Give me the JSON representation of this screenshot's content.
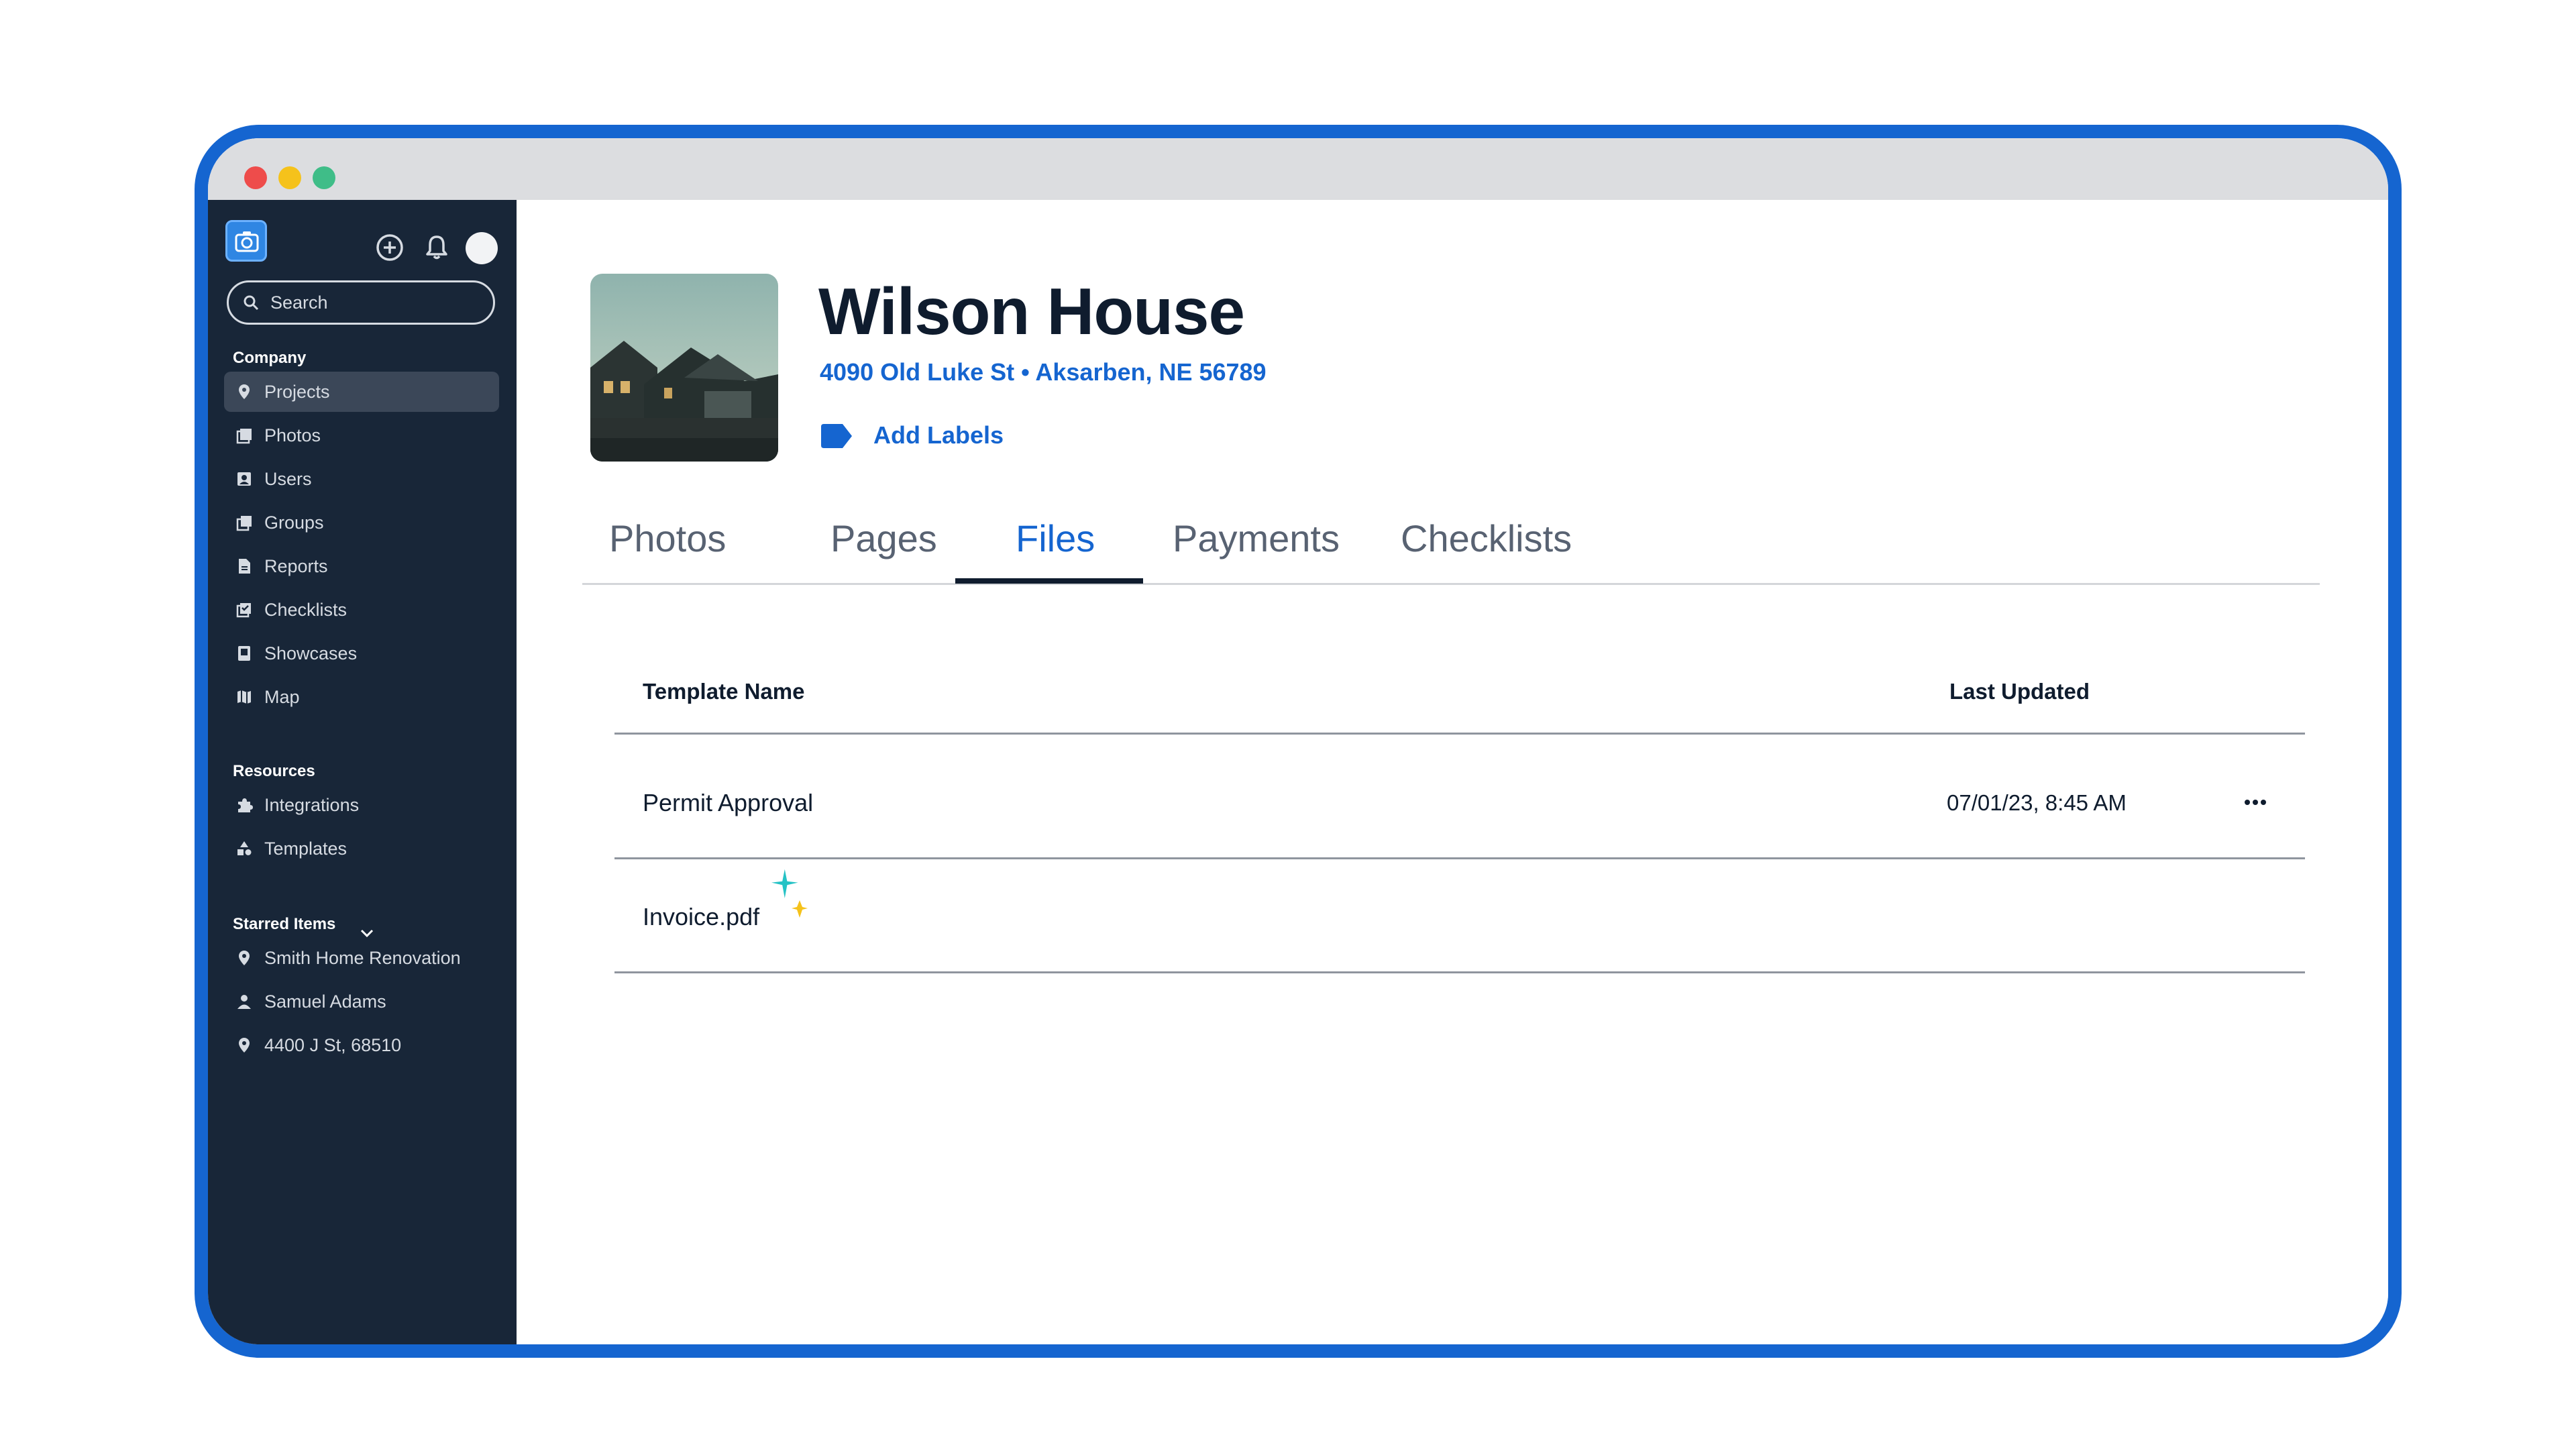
{
  "sidebar": {
    "search_placeholder": "Search",
    "company_title": "Company",
    "company_items": [
      {
        "label": "Projects",
        "icon": "pin-icon",
        "active": true
      },
      {
        "label": "Photos",
        "icon": "photos-icon"
      },
      {
        "label": "Users",
        "icon": "user-card-icon"
      },
      {
        "label": "Groups",
        "icon": "groups-icon"
      },
      {
        "label": "Reports",
        "icon": "report-icon"
      },
      {
        "label": "Checklists",
        "icon": "checklist-icon"
      },
      {
        "label": "Showcases",
        "icon": "showcase-icon"
      },
      {
        "label": "Map",
        "icon": "map-icon"
      }
    ],
    "resources_title": "Resources",
    "resource_items": [
      {
        "label": "Integrations",
        "icon": "puzzle-icon"
      },
      {
        "label": "Templates",
        "icon": "shapes-icon"
      }
    ],
    "starred_title": "Starred Items",
    "starred_items": [
      {
        "label": "Smith Home Renovation",
        "icon": "pin-icon"
      },
      {
        "label": "Samuel Adams",
        "icon": "person-icon"
      },
      {
        "label": "4400 J St, 68510",
        "icon": "pin-icon"
      }
    ]
  },
  "project": {
    "title": "Wilson House",
    "address": "4090 Old Luke St • Aksarben, NE 56789",
    "add_labels": "Add Labels"
  },
  "tabs": [
    {
      "label": "Photos"
    },
    {
      "label": "Pages"
    },
    {
      "label": "Files",
      "active": true
    },
    {
      "label": "Payments"
    },
    {
      "label": "Checklists"
    }
  ],
  "files_table": {
    "columns": [
      "Template Name",
      "Last Updated"
    ],
    "rows": [
      {
        "name": "Permit Approval",
        "updated": "07/01/23, 8:45 AM"
      },
      {
        "name": "Invoice.pdf",
        "updated": ""
      }
    ]
  },
  "colors": {
    "accent": "#1565d0",
    "sidebar_bg": "#182638",
    "frame": "#1565d0"
  }
}
